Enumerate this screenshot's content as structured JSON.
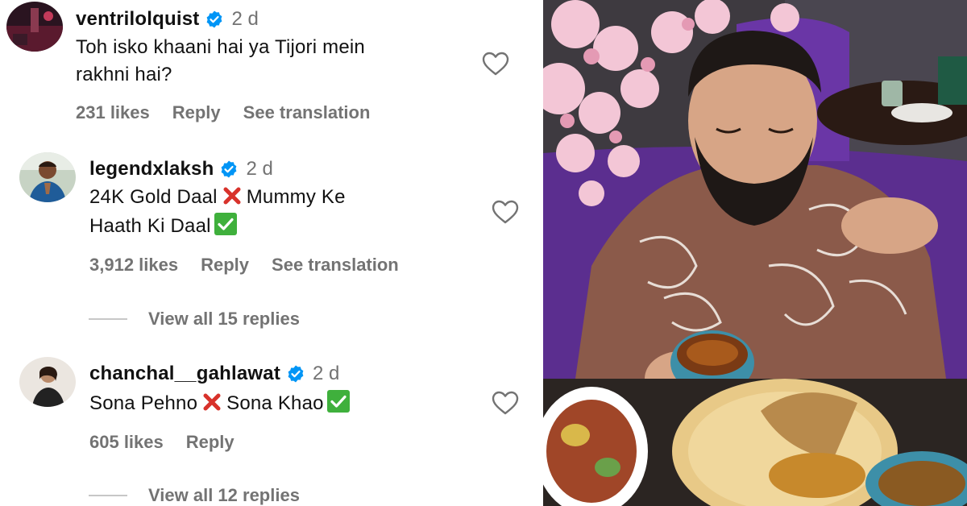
{
  "comments": [
    {
      "username": "ventrilolquist",
      "time": "2 d",
      "lines": [
        "Toh isko khaani hai ya Tijori mein",
        "rakhni hai?"
      ],
      "likes": "231 likes",
      "reply": "Reply",
      "see_translation": "See translation"
    },
    {
      "username": "legendxlaksh",
      "time": "2 d",
      "line1_a": "24K Gold Daal",
      "line1_b": "Mummy Ke",
      "line2": "Haath Ki Daal",
      "likes": "3,912 likes",
      "reply": "Reply",
      "see_translation": "See translation",
      "view_replies": "View all 15 replies"
    },
    {
      "username": "chanchal__gahlawat",
      "time": "2 d",
      "text_a": "Sona Pehno",
      "text_b": "Sona Khao",
      "likes": "605 likes",
      "reply": "Reply",
      "view_replies": "View all 12 replies"
    }
  ],
  "icons": {
    "verified": "verified-badge-icon",
    "heart": "heart-outline-icon",
    "cross": "cross-mark-emoji",
    "check": "check-mark-button-emoji"
  },
  "colors": {
    "verified_blue": "#0095f6",
    "meta_gray": "#737373",
    "cross_red": "#d8322b",
    "check_green": "#3fb03c"
  }
}
